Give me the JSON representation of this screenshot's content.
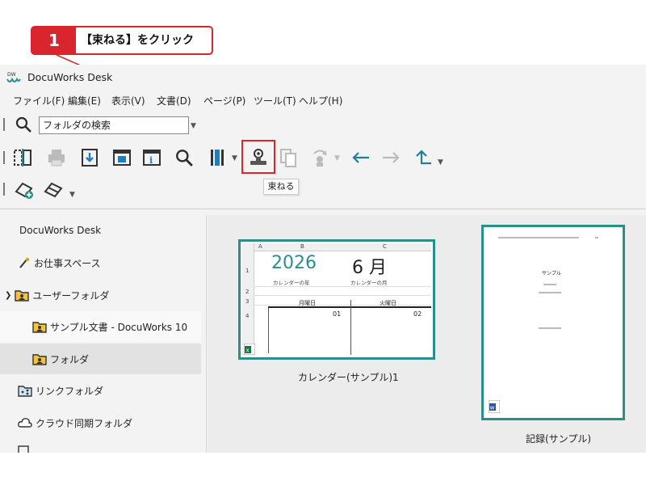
{
  "callout": {
    "number": "1",
    "text": "【束ねる】をクリック",
    "color": "#d9252e"
  },
  "window": {
    "title": "DocuWorks Desk",
    "menu": [
      "ファイル(F)",
      "編集(E)",
      "表示(V)",
      "文書(D)",
      "ページ(P)",
      "ツール(T)",
      "ヘルプ(H)"
    ],
    "search": {
      "value": "フォルダの検索"
    },
    "toolbar_icons": [
      "split-icon",
      "print-icon",
      "import-icon",
      "viewer-icon",
      "info-icon",
      "zoom-icon",
      "column-icon",
      "bundle-icon",
      "copy-icon",
      "hand-icon",
      "back-arrow-icon",
      "forward-arrow-icon",
      "up-folder-icon"
    ],
    "tooltip": "束ねる",
    "accent": "#2a8f8a"
  },
  "sidebar": {
    "items": [
      {
        "label": "DocuWorks Desk",
        "icon": "none"
      },
      {
        "label": "お仕事スペース",
        "icon": "pen-icon"
      },
      {
        "label": "ユーザーフォルダ",
        "icon": "user-folder-icon"
      },
      {
        "label": "サンプル文書 - DocuWorks 10",
        "icon": "user-folder-icon"
      },
      {
        "label": "フォルダ",
        "icon": "user-folder-icon"
      },
      {
        "label": "リンクフォルダ",
        "icon": "link-folder-icon"
      },
      {
        "label": "クラウド同期フォルダ",
        "icon": "cloud-icon"
      }
    ]
  },
  "documents": [
    {
      "label": "カレンダー(サンプル)1",
      "preview": {
        "cols": [
          "A",
          "B",
          "C"
        ],
        "rows": [
          "1",
          "2",
          "3",
          "4"
        ],
        "year": "2026",
        "month": "6 月",
        "year_caption": "カレンダーの年",
        "month_caption": "カレンダーの月",
        "day1": "月曜日",
        "day2": "火曜日",
        "date1": "01",
        "date2": "02"
      }
    },
    {
      "label": "記録(サンプル)",
      "preview": {
        "heading": "サンプル"
      }
    }
  ]
}
